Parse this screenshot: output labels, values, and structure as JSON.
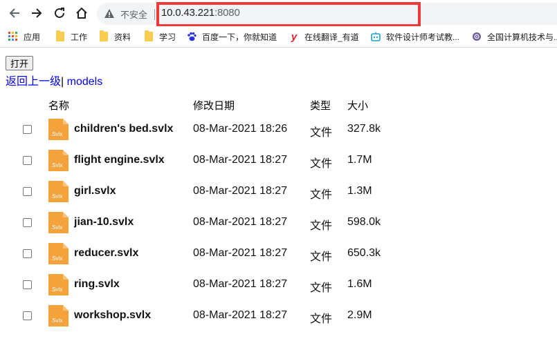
{
  "browser": {
    "security_label": "不安全",
    "url_host": "10.0.43.221",
    "url_port": ":8080"
  },
  "bookmarks": [
    {
      "label": "应用",
      "icon": "apps-grid-icon"
    },
    {
      "label": "工作",
      "icon": "folder-icon"
    },
    {
      "label": "资料",
      "icon": "folder-icon"
    },
    {
      "label": "学习",
      "icon": "folder-icon"
    },
    {
      "label": "百度一下，你就知道",
      "icon": "baidu-paw-icon"
    },
    {
      "label": "在线翻译_有道",
      "icon": "youdao-icon"
    },
    {
      "label": "软件设计师考试教...",
      "icon": "bot-icon"
    },
    {
      "label": "全国计算机技术与...",
      "icon": "globe-icon"
    }
  ],
  "page": {
    "open_button": "打开",
    "breadcrumb_back": "返回上一级",
    "breadcrumb_sep": "|",
    "breadcrumb_current": " models",
    "columns": {
      "name": "名称",
      "date": "修改日期",
      "type": "类型",
      "size": "大小"
    },
    "file_icon_label": ".Svlx",
    "files": [
      {
        "name": "children's bed.svlx",
        "date": "08-Mar-2021 18:26",
        "type": "文件",
        "size": "327.8k"
      },
      {
        "name": "flight engine.svlx",
        "date": "08-Mar-2021 18:27",
        "type": "文件",
        "size": "1.7M"
      },
      {
        "name": "girl.svlx",
        "date": "08-Mar-2021 18:27",
        "type": "文件",
        "size": "1.3M"
      },
      {
        "name": "jian-10.svlx",
        "date": "08-Mar-2021 18:27",
        "type": "文件",
        "size": "598.0k"
      },
      {
        "name": "reducer.svlx",
        "date": "08-Mar-2021 18:27",
        "type": "文件",
        "size": "650.3k"
      },
      {
        "name": "ring.svlx",
        "date": "08-Mar-2021 18:27",
        "type": "文件",
        "size": "1.6M"
      },
      {
        "name": "workshop.svlx",
        "date": "08-Mar-2021 18:27",
        "type": "文件",
        "size": "2.9M"
      }
    ]
  },
  "colors": {
    "highlight_box": "#ee3a3a",
    "link": "#0000ee",
    "file_icon": "#f4a23c",
    "folder_bookmark": "#f8cc4d"
  }
}
